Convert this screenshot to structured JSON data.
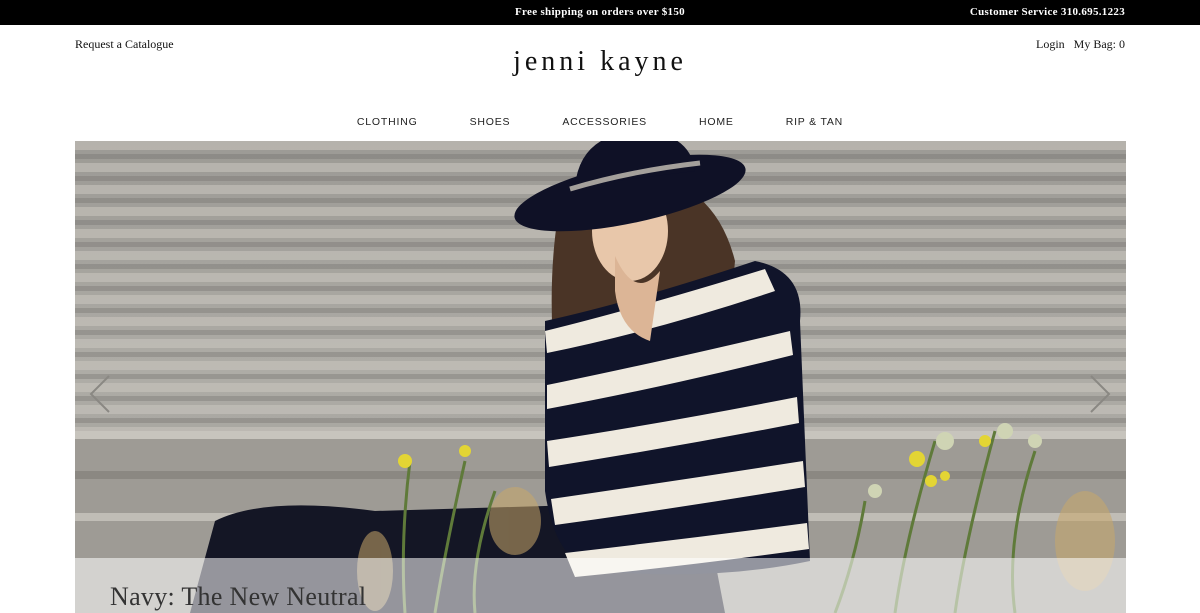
{
  "topbar": {
    "promo": "Free shipping on orders over $150",
    "service": "Customer Service 310.695.1223"
  },
  "header": {
    "catalogue": "Request a Catalogue",
    "login": "Login",
    "bag": "My Bag: 0",
    "logo": "jenni kayne"
  },
  "nav": {
    "items": [
      {
        "label": "CLOTHING"
      },
      {
        "label": "SHOES"
      },
      {
        "label": "ACCESSORIES"
      },
      {
        "label": "HOME"
      },
      {
        "label": "RIP & TAN"
      }
    ]
  },
  "hero": {
    "caption": "Navy: The New Neutral",
    "colors": {
      "wall": "#a9a7a1",
      "navy": "#101426",
      "cream": "#f1ece2"
    }
  }
}
